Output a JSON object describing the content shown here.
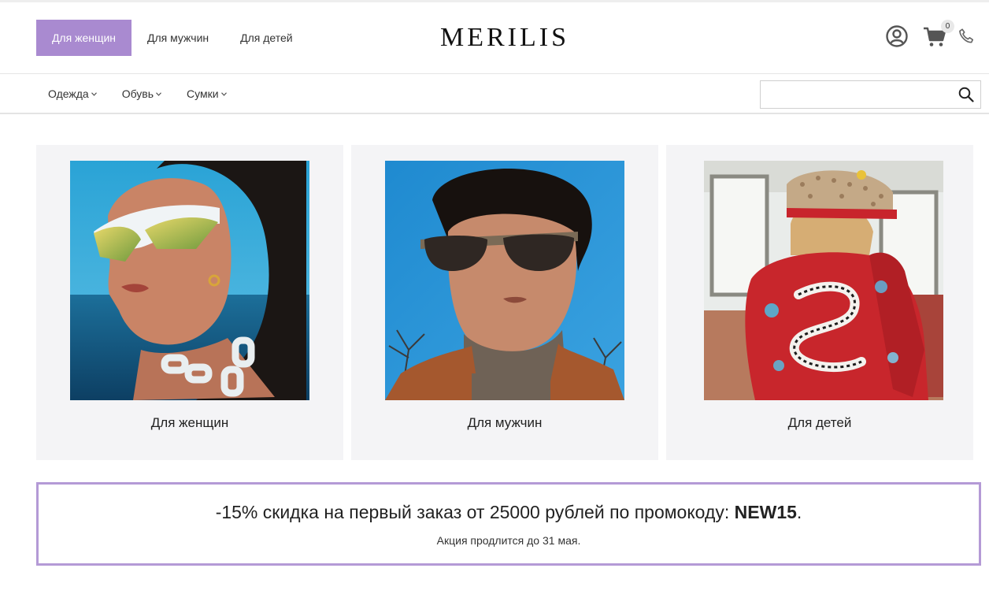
{
  "header": {
    "gender_tabs": [
      {
        "label": "Для женщин",
        "active": true
      },
      {
        "label": "Для мужчин",
        "active": false
      },
      {
        "label": "Для детей",
        "active": false
      }
    ],
    "logo": "MERILIS",
    "cart_count": "0",
    "icons": [
      "account-icon",
      "cart-icon",
      "phone-icon"
    ]
  },
  "category_nav": {
    "items": [
      {
        "label": "Одежда"
      },
      {
        "label": "Обувь"
      },
      {
        "label": "Сумки"
      }
    ],
    "search_value": "",
    "search_placeholder": ""
  },
  "cards": [
    {
      "caption": "Для женщин"
    },
    {
      "caption": "Для мужчин"
    },
    {
      "caption": "Для детей"
    }
  ],
  "promo": {
    "text_before": "-15% скидка на первый заказ от 25000 рублей по промокоду: ",
    "code": "NEW15",
    "text_after": ".",
    "subtext": "Акция продлится до 31 мая."
  },
  "colors": {
    "accent": "#a98ad0",
    "promo_border": "#b49ad6",
    "card_bg": "#f4f4f6"
  }
}
